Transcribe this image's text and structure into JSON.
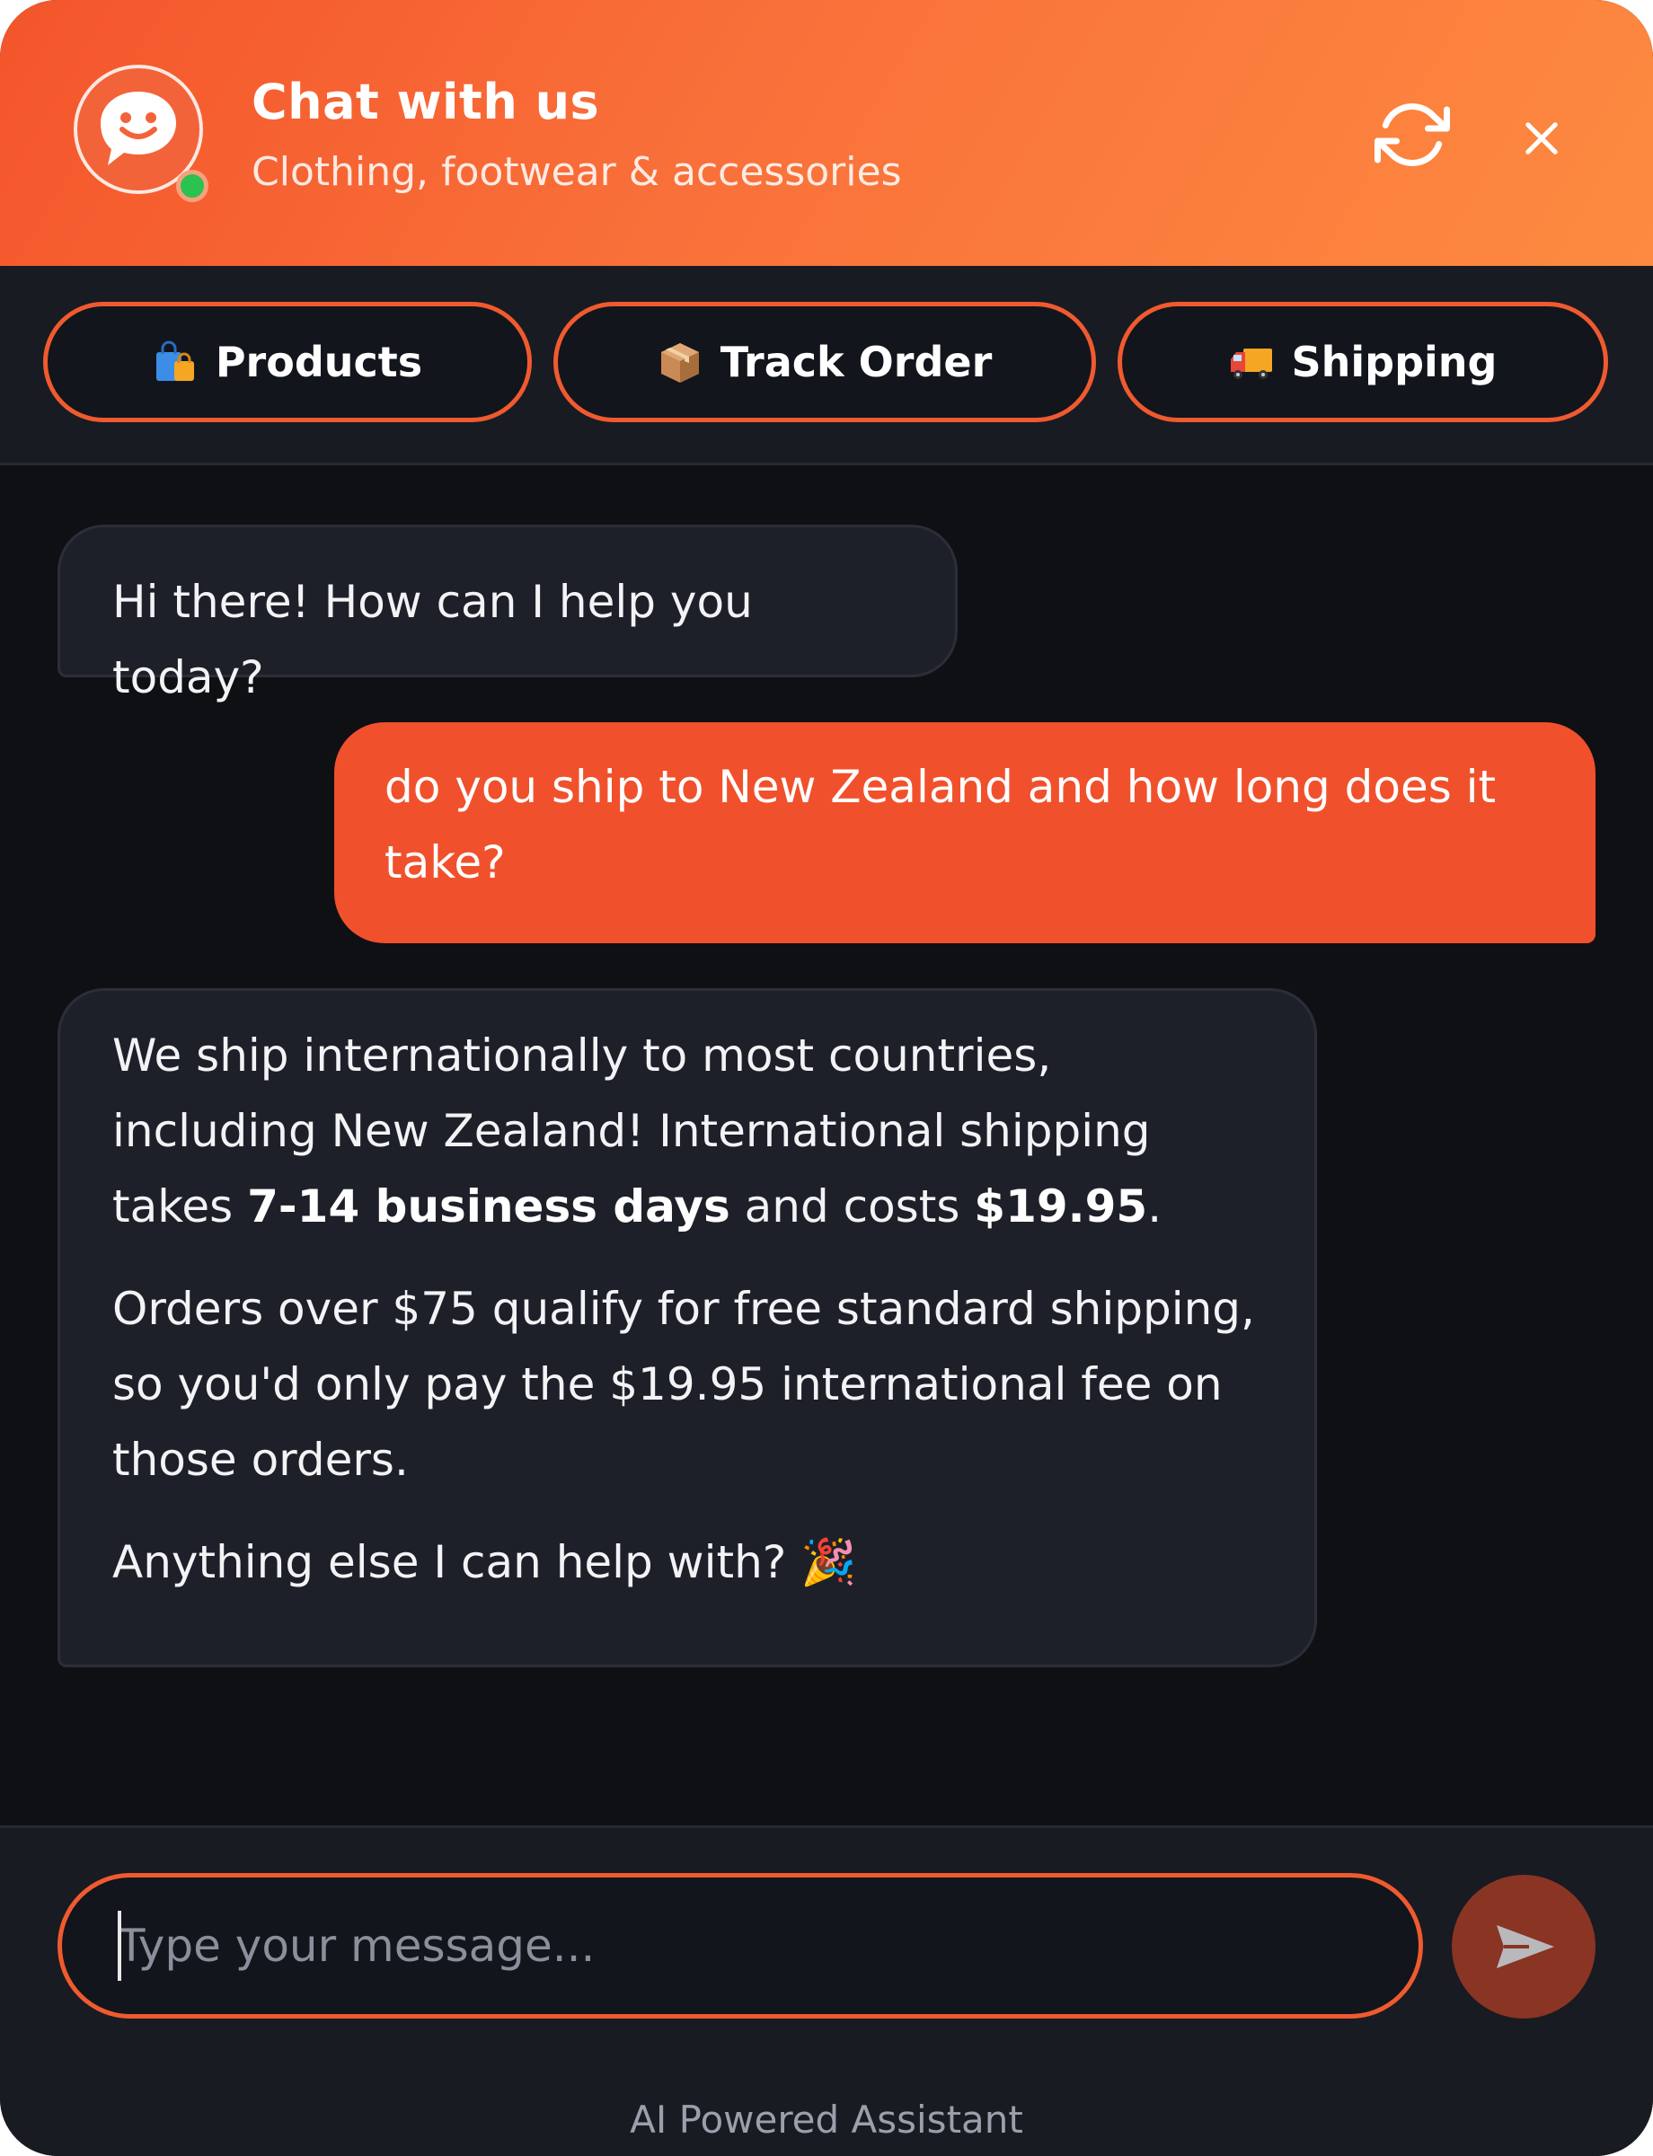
{
  "header": {
    "title": "Chat with us",
    "subtitle": "Clothing, footwear & accessories",
    "avatar_icon": "chat-smiley-icon",
    "status": "online",
    "accent_color": "#f4552b",
    "status_color": "#2bc24f"
  },
  "quick_actions": [
    {
      "label": "Products",
      "icon": "shopping-bags-icon"
    },
    {
      "label": "Track Order",
      "icon": "package-icon"
    },
    {
      "label": "Shipping",
      "icon": "delivery-truck-icon"
    }
  ],
  "messages": [
    {
      "role": "bot",
      "paragraphs": [
        [
          {
            "text": "Hi there! How can I help you today?"
          }
        ]
      ]
    },
    {
      "role": "user",
      "paragraphs": [
        [
          {
            "text": "do you ship to New Zealand and how long does it take?"
          }
        ]
      ]
    },
    {
      "role": "bot",
      "paragraphs": [
        [
          {
            "text": "We ship internationally to most countries, including New Zealand! International shipping takes "
          },
          {
            "text": "7-14 business days",
            "bold": true
          },
          {
            "text": " and costs "
          },
          {
            "text": "$19.95",
            "bold": true
          },
          {
            "text": "."
          }
        ],
        [
          {
            "text": "Orders over $75 qualify for free standard shipping, so you'd only pay the $19.95 international fee on those orders."
          }
        ],
        [
          {
            "text": "Anything else I can help with? "
          },
          {
            "text": "🎉",
            "emoji": true
          }
        ]
      ]
    }
  ],
  "input": {
    "placeholder": "Type your message...",
    "value": ""
  },
  "send_button_icon": "send-icon",
  "footer": {
    "note": "AI Powered Assistant"
  }
}
